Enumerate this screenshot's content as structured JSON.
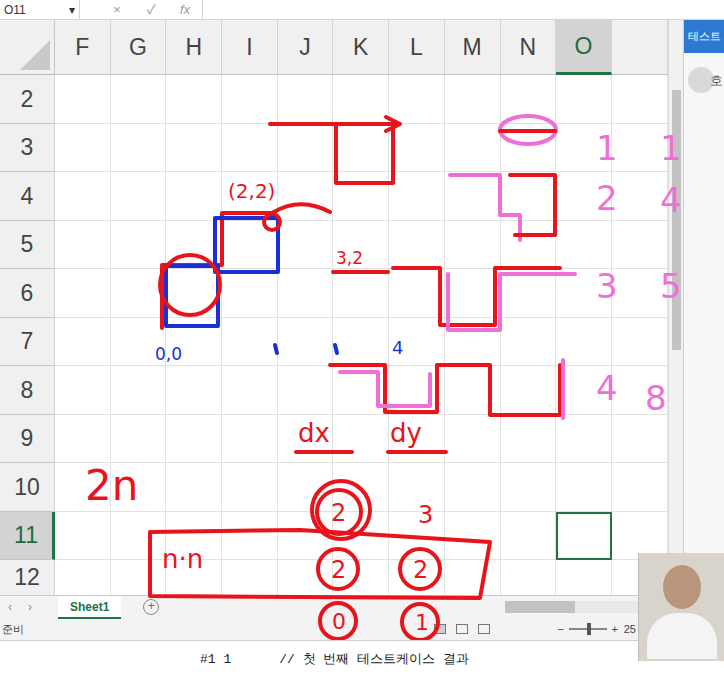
{
  "formula_bar": {
    "name_box": "O11",
    "name_box_arrow": "▾",
    "cancel": "×",
    "enter": "✓",
    "fx": "fx"
  },
  "side_panel": {
    "button": "테스트",
    "partial_text": "호"
  },
  "columns": [
    {
      "label": "F",
      "selected": false
    },
    {
      "label": "G",
      "selected": false
    },
    {
      "label": "H",
      "selected": false
    },
    {
      "label": "I",
      "selected": false
    },
    {
      "label": "J",
      "selected": false
    },
    {
      "label": "K",
      "selected": false
    },
    {
      "label": "L",
      "selected": false
    },
    {
      "label": "M",
      "selected": false
    },
    {
      "label": "N",
      "selected": false
    },
    {
      "label": "O",
      "selected": true
    }
  ],
  "rows": [
    {
      "label": "2",
      "selected": false
    },
    {
      "label": "3",
      "selected": false
    },
    {
      "label": "4",
      "selected": false
    },
    {
      "label": "5",
      "selected": false
    },
    {
      "label": "6",
      "selected": false
    },
    {
      "label": "7",
      "selected": false
    },
    {
      "label": "8",
      "selected": false
    },
    {
      "label": "9",
      "selected": false
    },
    {
      "label": "10",
      "selected": false
    },
    {
      "label": "11",
      "selected": true
    },
    {
      "label": "12",
      "selected": false
    }
  ],
  "sheet_tabs": {
    "prev": "‹",
    "next": "›",
    "add": "+",
    "tabs": [
      {
        "label": "Sheet1",
        "selected": true
      }
    ]
  },
  "status_bar": {
    "mode": "준비",
    "views": [
      {
        "selected": true
      },
      {
        "selected": false
      },
      {
        "selected": false
      }
    ],
    "zoom_minus": "−",
    "zoom_plus": "+",
    "zoom_level": 0.55,
    "zoom": "25"
  },
  "console": {
    "case": "#1 1",
    "comment": "// 첫 번째 테스트케이스 결과"
  },
  "annotations": [
    {
      "text": "(2,2)",
      "color": "#e8141b"
    },
    {
      "text": "3,2",
      "color": "#e8141b"
    },
    {
      "text": "0,0",
      "color": "#1a2fd6"
    },
    {
      "text": "4",
      "color": "#1a2fd6"
    },
    {
      "text": "1",
      "color": "#f06fd6"
    },
    {
      "text": "1",
      "color": "#f06fd6"
    },
    {
      "text": "2",
      "color": "#f06fd6"
    },
    {
      "text": "4",
      "color": "#f06fd6"
    },
    {
      "text": "3",
      "color": "#f06fd6"
    },
    {
      "text": "5",
      "color": "#f06fd6"
    },
    {
      "text": "4",
      "color": "#f06fd6"
    },
    {
      "text": "8",
      "color": "#f06fd6"
    },
    {
      "text": "dx",
      "color": "#e8141b"
    },
    {
      "text": "dy",
      "color": "#e8141b"
    },
    {
      "text": "2n",
      "color": "#e8141b"
    },
    {
      "text": "n·n",
      "color": "#e8141b"
    },
    {
      "text": "2",
      "color": "#e8141b"
    },
    {
      "text": "3",
      "color": "#e8141b"
    },
    {
      "text": "2",
      "color": "#e8141b"
    },
    {
      "text": "2",
      "color": "#e8141b"
    },
    {
      "text": "0",
      "color": "#e8141b"
    },
    {
      "text": "1",
      "color": "#e8141b"
    }
  ]
}
